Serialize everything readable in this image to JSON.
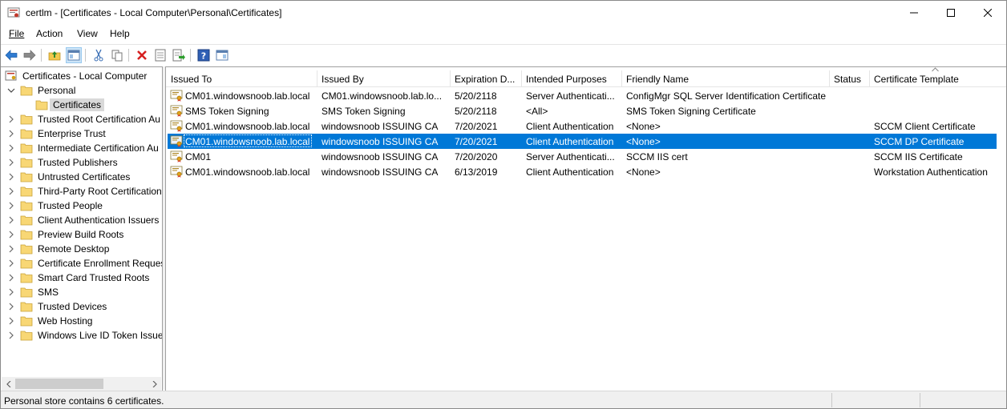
{
  "window": {
    "title": "certlm - [Certificates - Local Computer\\Personal\\Certificates]",
    "app_icon": "certificate-manager-icon"
  },
  "menu": {
    "file": "File",
    "action": "Action",
    "view": "View",
    "help": "Help"
  },
  "toolbar": {
    "icons": [
      "back-arrow-icon",
      "forward-arrow-icon",
      "up-folder-icon",
      "show-hide-console-tree-icon",
      "cut-icon",
      "copy-icon",
      "delete-icon",
      "properties-icon",
      "export-list-icon",
      "help-icon",
      "show-hide-action-pane-icon"
    ]
  },
  "tree": {
    "root": "Certificates - Local Computer",
    "personal": "Personal",
    "certificates": "Certificates",
    "stores": [
      "Trusted Root Certification Au",
      "Enterprise Trust",
      "Intermediate Certification Au",
      "Trusted Publishers",
      "Untrusted Certificates",
      "Third-Party Root Certification",
      "Trusted People",
      "Client Authentication Issuers",
      "Preview Build Roots",
      "Remote Desktop",
      "Certificate Enrollment Reques",
      "Smart Card Trusted Roots",
      "SMS",
      "Trusted Devices",
      "Web Hosting",
      "Windows Live ID Token Issuer"
    ]
  },
  "list": {
    "columns": [
      "Issued To",
      "Issued By",
      "Expiration D...",
      "Intended Purposes",
      "Friendly Name",
      "Status",
      "Certificate Template"
    ],
    "rows": [
      {
        "issued_to": "CM01.windowsnoob.lab.local",
        "issued_by": "CM01.windowsnoob.lab.lo...",
        "expiration": "5/20/2118",
        "purposes": "Server Authenticati...",
        "friendly": "ConfigMgr SQL Server Identification Certificate",
        "status": "",
        "template": ""
      },
      {
        "issued_to": "SMS Token Signing",
        "issued_by": "SMS Token Signing",
        "expiration": "5/20/2118",
        "purposes": "<All>",
        "friendly": "SMS Token Signing Certificate",
        "status": "",
        "template": ""
      },
      {
        "issued_to": "CM01.windowsnoob.lab.local",
        "issued_by": "windowsnoob ISSUING CA",
        "expiration": "7/20/2021",
        "purposes": "Client Authentication",
        "friendly": "<None>",
        "status": "",
        "template": "SCCM Client Certificate"
      },
      {
        "issued_to": "CM01.windowsnoob.lab.local",
        "issued_by": "windowsnoob ISSUING CA",
        "expiration": "7/20/2021",
        "purposes": "Client Authentication",
        "friendly": "<None>",
        "status": "",
        "template": "SCCM DP Certificate"
      },
      {
        "issued_to": "CM01",
        "issued_by": "windowsnoob ISSUING CA",
        "expiration": "7/20/2020",
        "purposes": "Server Authenticati...",
        "friendly": "SCCM IIS cert",
        "status": "",
        "template": "SCCM IIS Certificate"
      },
      {
        "issued_to": "CM01.windowsnoob.lab.local",
        "issued_by": "windowsnoob ISSUING CA",
        "expiration": "6/13/2019",
        "purposes": "Client Authentication",
        "friendly": "<None>",
        "status": "",
        "template": "Workstation Authentication"
      }
    ],
    "selected_row": 4
  },
  "statusbar": {
    "text": "Personal store contains 6 certificates."
  },
  "colors": {
    "selection": "#0078d7",
    "folder": "#f8d775",
    "tree_selected": "#d9d9d9"
  }
}
